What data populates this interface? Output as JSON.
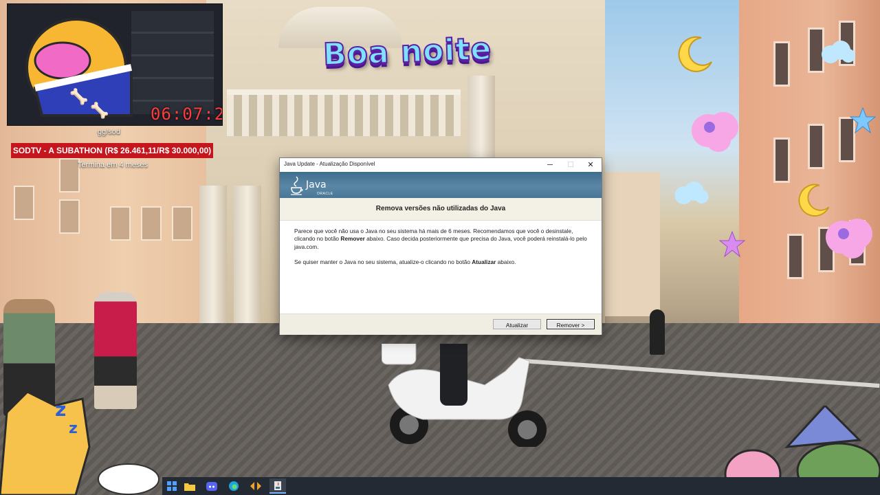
{
  "stream": {
    "timer": "06:07:25",
    "handle": "gg/sod",
    "subathon_label": "SODTV - A SUBATHON (R$ 26.461,11/R$ 30.000,00)",
    "subathon_status": "Termina em 4 meses",
    "greeting": "Boa noite"
  },
  "dialog": {
    "title": "Java Update - Atualização Disponível",
    "brand": {
      "logo_text": "Java",
      "logo_sub": "ORACLE"
    },
    "heading": "Remova versões não utilizadas do Java",
    "paragraph1": {
      "part1": "Parece que você não usa o Java no seu sistema há mais de 6 meses. Recomendamos que você o desinstale, clicando no botão ",
      "bold": "Remover",
      "part2": " abaixo. Caso decida posteriormente que precisa do Java, você poderá reinstalá-lo pelo java.com."
    },
    "paragraph2": {
      "part1": "Se quiser manter o Java no seu sistema, atualize-o clicando no botão ",
      "bold": "Atualizar",
      "part2": " abaixo."
    },
    "buttons": {
      "update": "Atualizar",
      "remove": "Remover >"
    },
    "window_controls": {
      "minimize": "─",
      "maximize": "☐",
      "close": "✕"
    }
  },
  "taskbar": {
    "items": [
      "windows-icon",
      "file-explorer-icon",
      "discord-icon",
      "edge-icon",
      "media-app-icon",
      "java-update-icon"
    ]
  },
  "colors": {
    "java_banner": "#4a7795",
    "subathon_red": "#c4161c",
    "timer_red": "#ff3b3b",
    "greeting_cyan": "#7fe0ff",
    "greeting_outline": "#5a1fa3"
  }
}
